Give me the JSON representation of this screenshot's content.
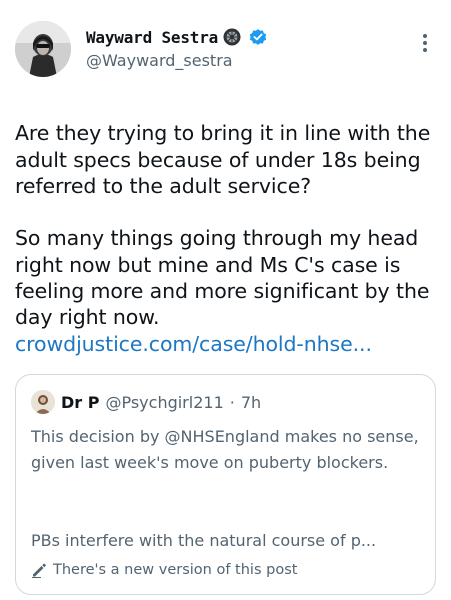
{
  "author": {
    "display_name": "Wayward Sestra",
    "handle": "@Wayward_sestra",
    "emoji_icon": "car-wheel",
    "verified_icon": "verified-badge"
  },
  "tweet": {
    "text": "Are they trying to bring it in line with the adult specs because of under 18s being referred to the adult service?\n\nSo many things going through my head right now but mine and Ms C's case is feeling more and more significant by the day right now.",
    "link": "crowdjustice.com/case/hold-nhse..."
  },
  "quote": {
    "name": "Dr P",
    "handle": "@Psychgirl211",
    "separator": "·",
    "time": "7h",
    "text": "This decision by @NHSEngland  makes no sense, given last week's move on puberty blockers.",
    "text_second": "PBs interfere with the natural course of p...",
    "edit_notice": "There's a new version of this post"
  },
  "colors": {
    "link": "#1d77c5",
    "verified": "#1d9bf0",
    "secondary_text": "#536471",
    "border": "#cfd9de"
  }
}
